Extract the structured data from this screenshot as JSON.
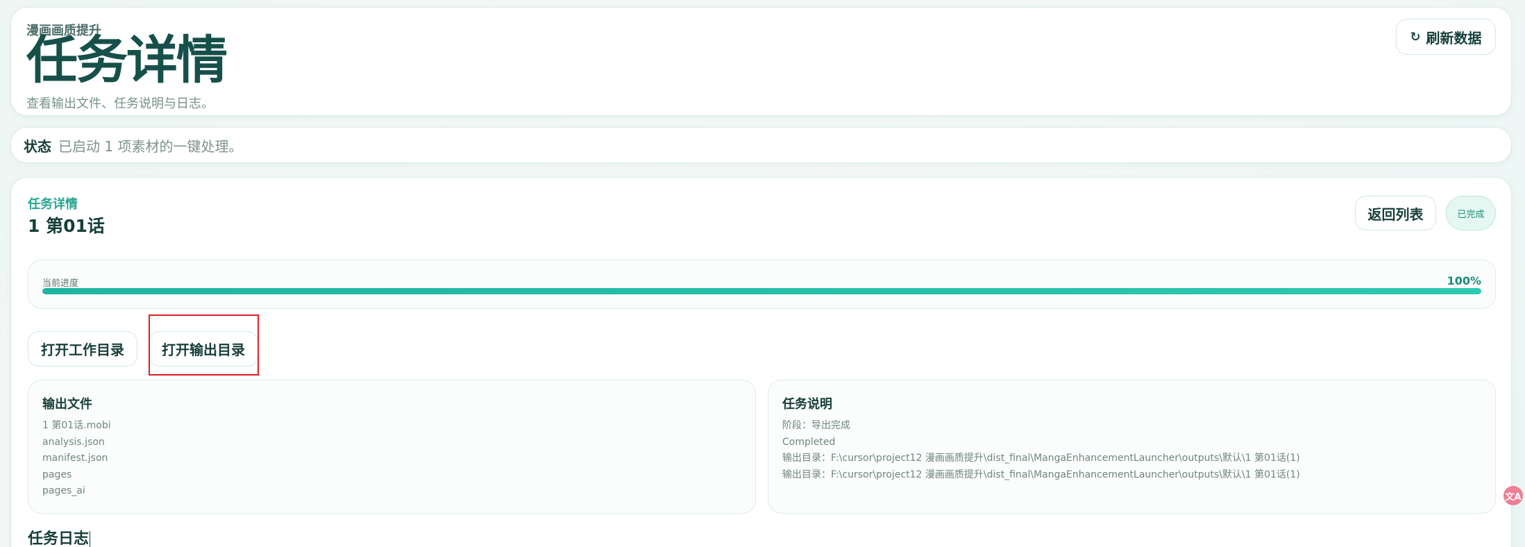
{
  "header": {
    "eyebrow": "漫画画质提升",
    "title": "任务详情",
    "subtitle": "查看输出文件、任务说明与日志。",
    "refresh_icon": "refresh-icon",
    "refresh_label": "刷新数据"
  },
  "status": {
    "label": "状态",
    "text": "已启动 1 项素材的一键处理。"
  },
  "task": {
    "eyebrow": "任务详情",
    "title": "1 第01话",
    "back_label": "返回列表",
    "status_badge": "已完成",
    "progress": {
      "label": "当前进度",
      "value_text": "100%",
      "fraction": 1.0
    },
    "actions": {
      "open_work_dir": "打开工作目录",
      "open_output_dir": "打开输出目录"
    },
    "output_files": {
      "title": "输出文件",
      "items": [
        "1 第01话.mobi",
        "analysis.json",
        "manifest.json",
        "pages",
        "pages_ai"
      ]
    },
    "description": {
      "title": "任务说明",
      "items": [
        "阶段：导出完成",
        "Completed",
        "输出目录：F:\\cursor\\project12 漫画画质提升\\dist_final\\MangaEnhancementLauncher\\outputs\\默认\\1 第01话(1)",
        "输出目录：F:\\cursor\\project12 漫画画质提升\\dist_final\\MangaEnhancementLauncher\\outputs\\默认\\1 第01话(1)"
      ]
    },
    "log_title": "任务日志"
  },
  "floating": {
    "translate_icon": "translate-icon",
    "translate_glyph": "文A"
  },
  "colors": {
    "accent": "#1fb5a0",
    "title": "#17504a",
    "highlight": "#e02020",
    "badge_bg": "#e4f7f1"
  }
}
